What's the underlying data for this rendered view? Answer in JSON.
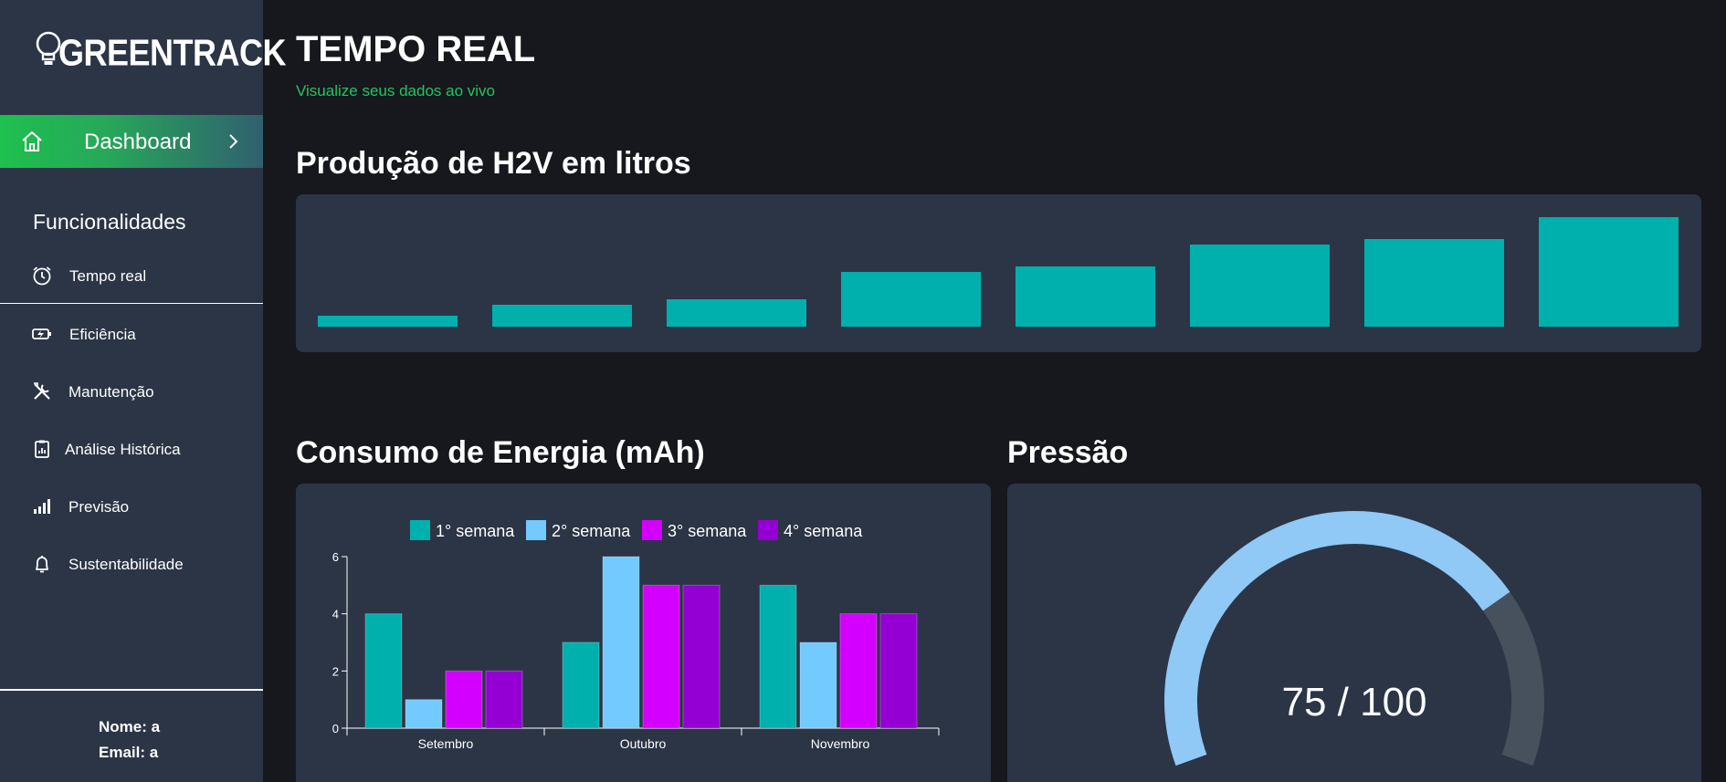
{
  "sidebar": {
    "logo": "GREENTRACK",
    "dashboard_label": "Dashboard",
    "section_title": "Funcionalidades",
    "items": [
      {
        "label": "Tempo real",
        "icon": "alarm-clock-icon"
      },
      {
        "label": "Eficiência",
        "icon": "battery-charging-icon"
      },
      {
        "label": "Manutenção",
        "icon": "tools-icon"
      },
      {
        "label": "Análise Histórica",
        "icon": "clipboard-icon"
      },
      {
        "label": "Previsão",
        "icon": "signal-bars-icon"
      },
      {
        "label": "Sustentabilidade",
        "icon": "bell-icon"
      }
    ],
    "user_name": "Nome: a",
    "user_email": "Email: a"
  },
  "header": {
    "title": "TEMPO REAL",
    "subtitle": "Visualize seus dados ao vivo"
  },
  "sections": {
    "production_title": "Produção de H2V em litros",
    "energy_title": "Consumo de Energia (mAh)",
    "pressure_title": "Pressão"
  },
  "colors": {
    "accent_green": "#22c55e",
    "teal": "#00b0ad",
    "light_blue": "#72caff",
    "magenta": "#d400ff",
    "purple": "#9400d3",
    "gauge_fill": "#90c8f6",
    "gauge_track": "#47505d"
  },
  "chart_data": [
    {
      "type": "bar",
      "values": [
        1,
        2,
        2.5,
        5,
        5.5,
        7.5,
        8,
        10
      ],
      "ylim": [
        0,
        10
      ]
    },
    {
      "type": "bar",
      "categories": [
        "Setembro",
        "Outubro",
        "Novembro"
      ],
      "series": [
        {
          "name": "1° semana",
          "values": [
            4,
            3,
            5
          ],
          "color": "#00b0ad"
        },
        {
          "name": "2° semana",
          "values": [
            1,
            6,
            3
          ],
          "color": "#72caff"
        },
        {
          "name": "3° semana",
          "values": [
            2,
            5,
            4
          ],
          "color": "#d400ff"
        },
        {
          "name": "4° semana",
          "values": [
            2,
            5,
            4
          ],
          "color": "#9400d3"
        }
      ],
      "yticks": [
        "0",
        "2",
        "4",
        "6"
      ],
      "ylim": [
        0,
        6
      ],
      "legend": "top"
    },
    {
      "type": "gauge",
      "value": 75,
      "max": 100,
      "label": "75 / 100"
    }
  ]
}
